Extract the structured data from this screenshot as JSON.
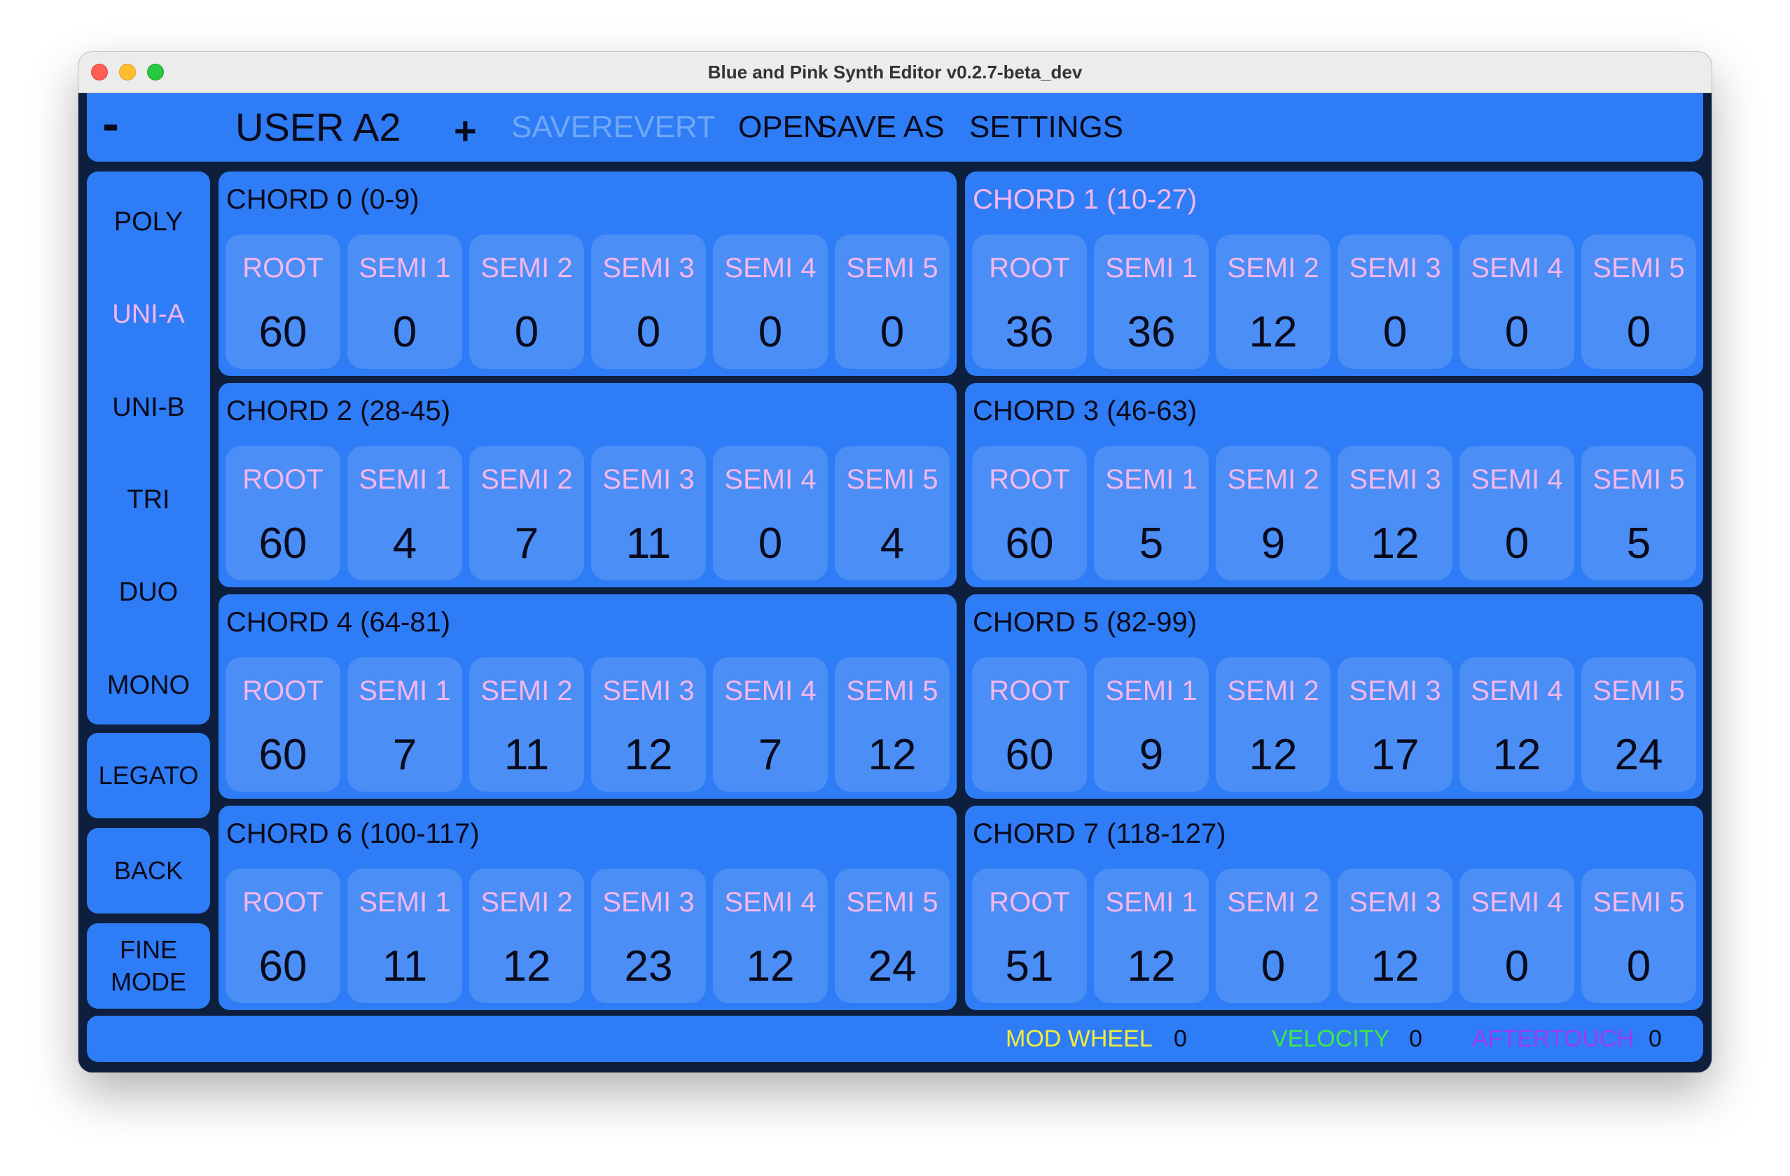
{
  "window": {
    "title": "Blue and Pink Synth Editor v0.2.7-beta_dev"
  },
  "topbar": {
    "prev": "-",
    "preset": "USER A2",
    "next": "+",
    "save": "SAVE",
    "revert": "REVERT",
    "open": "OPEN",
    "save_as": "SAVE AS",
    "settings": "SETTINGS"
  },
  "modes": [
    "POLY",
    "UNI-A",
    "UNI-B",
    "TRI",
    "DUO",
    "MONO"
  ],
  "selected_mode": "UNI-A",
  "side_buttons": {
    "legato": "LEGATO",
    "back": "BACK",
    "fine_mode_line1": "FINE",
    "fine_mode_line2": "MODE"
  },
  "slot_labels": [
    "ROOT",
    "SEMI 1",
    "SEMI 2",
    "SEMI 3",
    "SEMI 4",
    "SEMI 5"
  ],
  "chords": [
    {
      "title": "CHORD 0 (0-9)",
      "values": [
        "60",
        "0",
        "0",
        "0",
        "0",
        "0"
      ]
    },
    {
      "title": "CHORD 1 (10-27)",
      "values": [
        "36",
        "36",
        "12",
        "0",
        "0",
        "0"
      ]
    },
    {
      "title": "CHORD 2 (28-45)",
      "values": [
        "60",
        "4",
        "7",
        "11",
        "0",
        "4"
      ]
    },
    {
      "title": "CHORD 3 (46-63)",
      "values": [
        "60",
        "5",
        "9",
        "12",
        "0",
        "5"
      ]
    },
    {
      "title": "CHORD 4 (64-81)",
      "values": [
        "60",
        "7",
        "11",
        "12",
        "7",
        "12"
      ]
    },
    {
      "title": "CHORD 5 (82-99)",
      "values": [
        "60",
        "9",
        "12",
        "17",
        "12",
        "24"
      ]
    },
    {
      "title": "CHORD 6 (100-117)",
      "values": [
        "60",
        "11",
        "12",
        "23",
        "12",
        "24"
      ]
    },
    {
      "title": "CHORD 7 (118-127)",
      "values": [
        "51",
        "12",
        "0",
        "12",
        "0",
        "0"
      ]
    }
  ],
  "highlighted_chord": "CHORD 1 (10-27)",
  "status": {
    "mod_wheel_label": "MOD WHEEL",
    "mod_wheel_value": "0",
    "velocity_label": "VELOCITY",
    "velocity_value": "0",
    "aftertouch_label": "AFTERTOUCH",
    "aftertouch_value": "0"
  },
  "colors": {
    "panel": "#2e7cf6",
    "slot": "#4a8ef6",
    "background": "#0d1f3c",
    "accent_pink": "#f6b6ec",
    "disabled": "#70a8f6",
    "mod_wheel": "#f2ee3a",
    "velocity": "#3ee84c",
    "aftertouch": "#9a3cf0"
  }
}
